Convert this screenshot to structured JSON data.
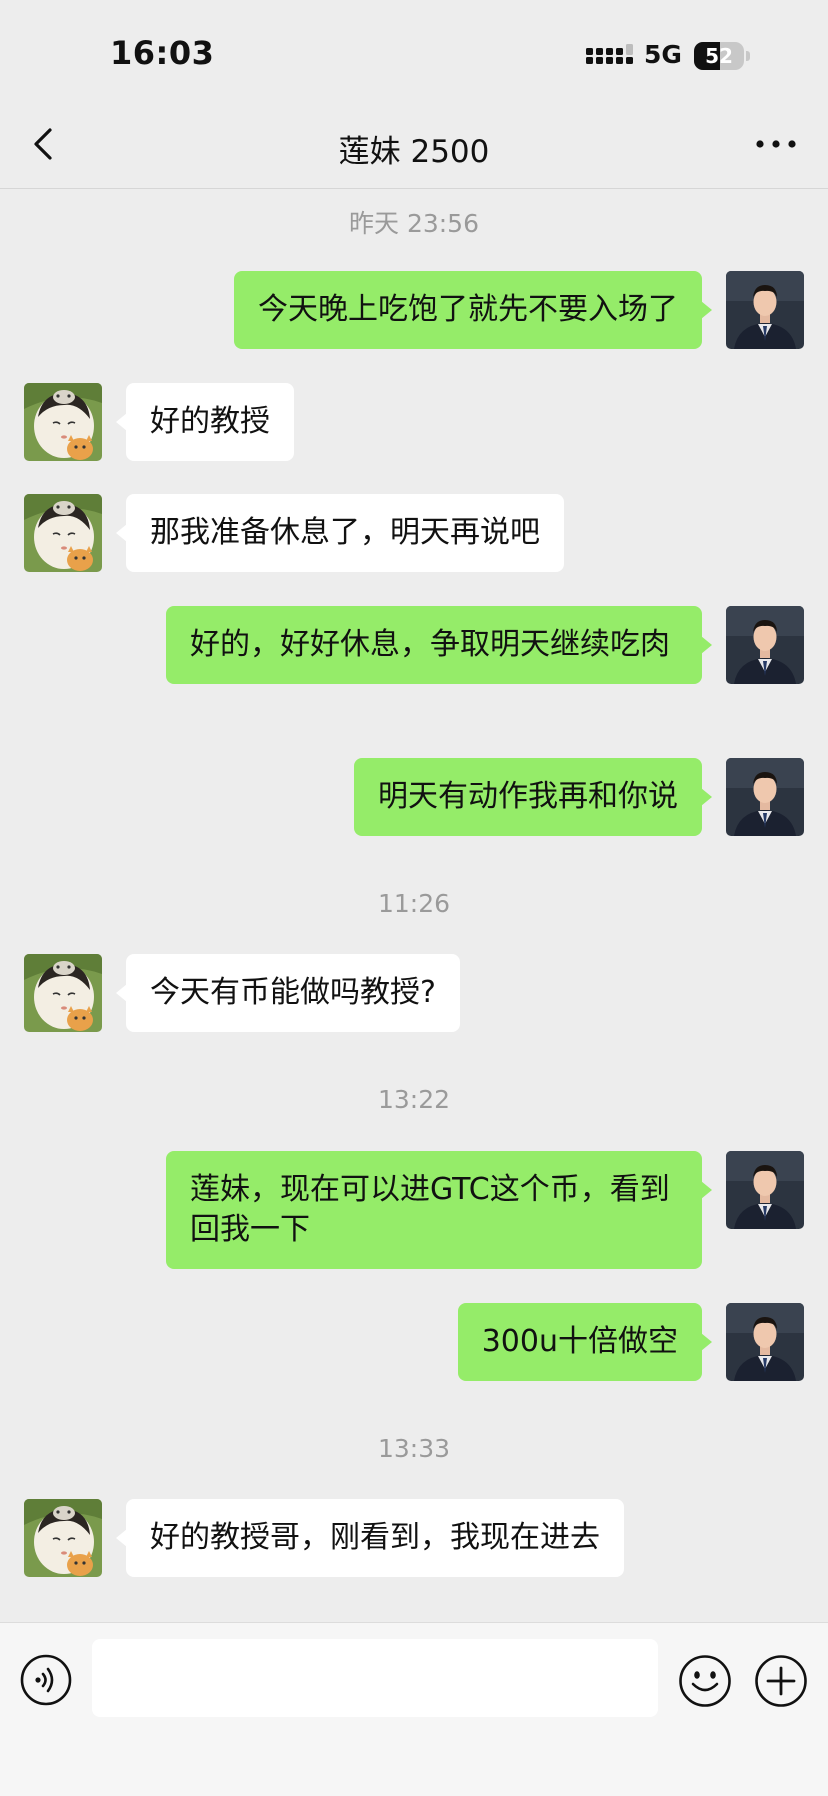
{
  "status_bar": {
    "time": "16:03",
    "network": "5G",
    "battery_level": "52",
    "battery_fraction": 0.52
  },
  "chat": {
    "title": "莲妹 2500"
  },
  "messages": [
    {
      "type": "timestamp",
      "text": "昨天 23:56"
    },
    {
      "type": "sent",
      "text": "今天晚上吃饱了就先不要入场了"
    },
    {
      "type": "received",
      "text": "好的教授"
    },
    {
      "type": "received",
      "text": "那我准备休息了，明天再说吧"
    },
    {
      "type": "sent",
      "text": "好的，好好休息，争取明天继续吃肉"
    },
    {
      "type": "sent",
      "text": "明天有动作我再和你说"
    },
    {
      "type": "timestamp",
      "text": "11:26"
    },
    {
      "type": "received",
      "text": "今天有币能做吗教授?"
    },
    {
      "type": "timestamp",
      "text": "13:22"
    },
    {
      "type": "sent",
      "text": "莲妹，现在可以进GTC这个币，看到回我一下"
    },
    {
      "type": "sent",
      "text": "300u十倍做空"
    },
    {
      "type": "timestamp",
      "text": "13:33"
    },
    {
      "type": "received",
      "text": "好的教授哥，刚看到，我现在进去"
    }
  ],
  "input_bar": {
    "text_value": "",
    "icons": [
      "voice-icon",
      "emoji-icon",
      "plus-icon"
    ]
  },
  "colors": {
    "sent_bubble": "#95ec69",
    "received_bubble": "#ffffff",
    "background": "#ededed"
  }
}
